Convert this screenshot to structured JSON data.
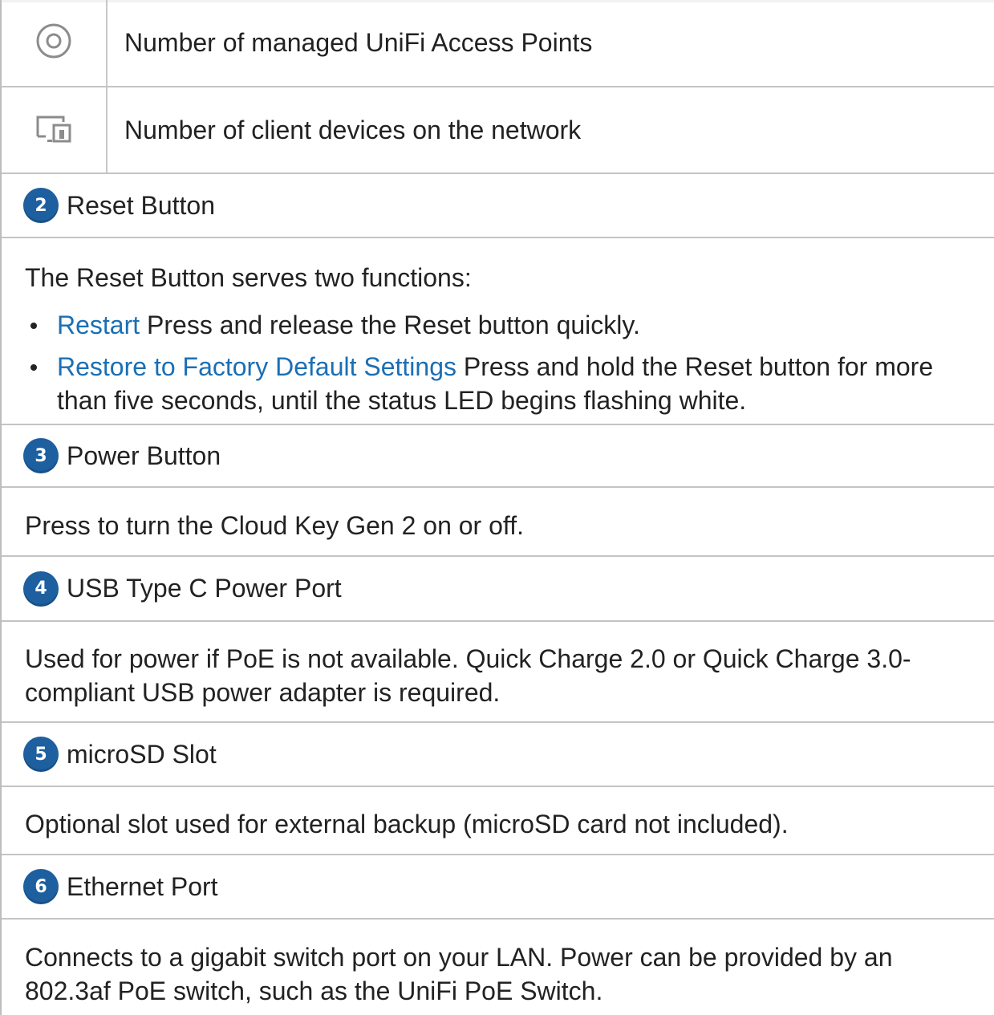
{
  "icon_rows": [
    {
      "icon": "access-point-icon",
      "text": "Number of managed UniFi Access Points"
    },
    {
      "icon": "client-devices-icon",
      "text": "Number of client devices on the network"
    }
  ],
  "sections": {
    "reset": {
      "number": "2",
      "title": "Reset Button",
      "intro": "The Reset Button serves two functions:",
      "items": [
        {
          "term": "Restart",
          "desc": " Press and release the Reset button quickly."
        },
        {
          "term": "Restore to Factory Default Settings",
          "desc": " Press and hold the Reset button for more than five seconds, until the status LED begins flashing white."
        }
      ]
    },
    "power": {
      "number": "3",
      "title": "Power Button",
      "body": "Press to turn the Cloud Key Gen 2 on or off."
    },
    "usb": {
      "number": "4",
      "title": "USB Type C Power Port",
      "body": "Used for power if PoE is not available. Quick Charge 2.0 or Quick Charge 3.0-compliant USB power adapter is required."
    },
    "microsd": {
      "number": "5",
      "title": "microSD Slot",
      "body": "Optional slot used for external backup (microSD card not included)."
    },
    "ethernet": {
      "number": "6",
      "title": "Ethernet Port",
      "body": "Connects to a gigabit switch port on your LAN. Power can be provided by an 802.3af PoE switch, such as the UniFi PoE Switch."
    }
  },
  "colors": {
    "badge": "#1d5f9f",
    "link": "#1a6fb5",
    "rule": "#c4c4c4"
  }
}
